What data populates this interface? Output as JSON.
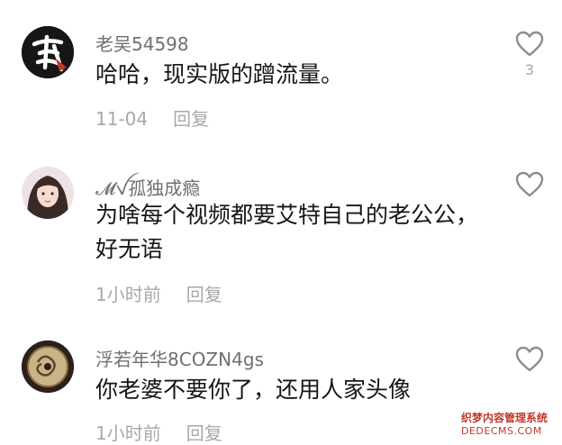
{
  "comments": [
    {
      "username": "老吴54598",
      "text": "哈哈，现实版的蹭流量。",
      "time": "11-04",
      "reply_label": "回复",
      "like_count": "3"
    },
    {
      "username": "𝓜ꪜ孤独成瘾",
      "text": "为啥每个视频都要艾特自己的老公公，好无语",
      "time": "1小时前",
      "reply_label": "回复",
      "like_count": ""
    },
    {
      "username": "浮若年华8COZN4gs",
      "text": "你老婆不要你了，还用人家头像",
      "time": "1小时前",
      "reply_label": "回复",
      "like_count": ""
    }
  ],
  "watermark": {
    "line1": "织梦内容管理系统",
    "line2": "DEDECMS.COM"
  },
  "colors": {
    "text": "#161616",
    "username": "#6f6f6f",
    "meta": "#a8a8a8",
    "heart": "#8c8c8c"
  }
}
